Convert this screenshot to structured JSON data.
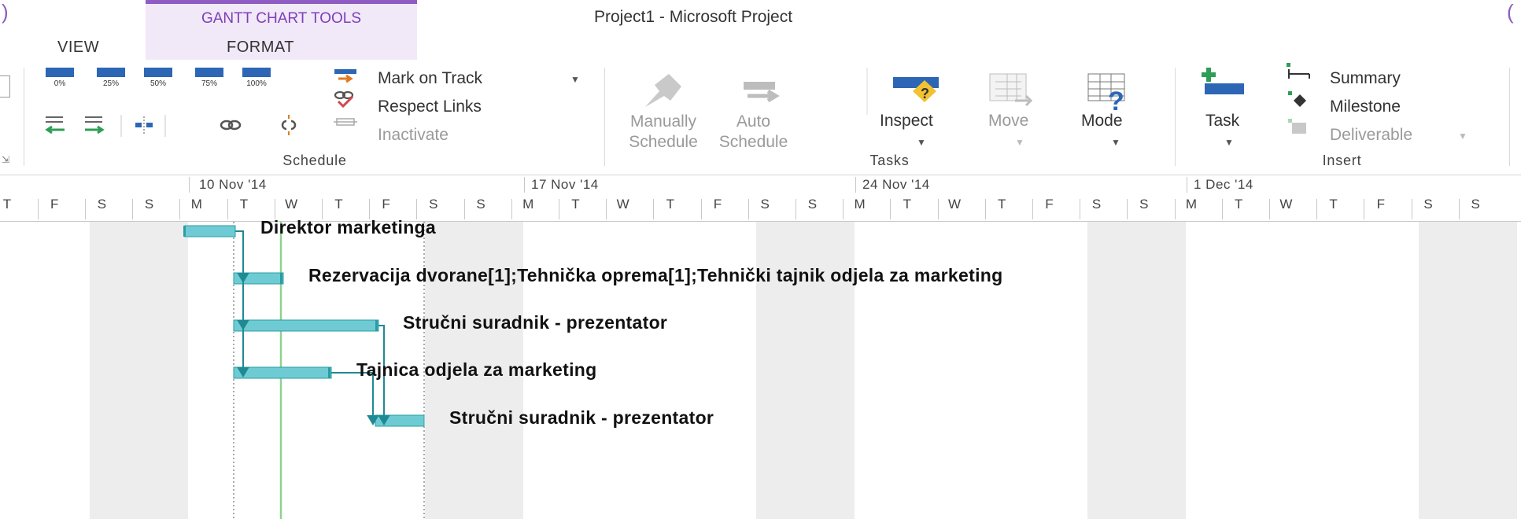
{
  "window": {
    "title": "Project1 - Microsoft Project",
    "contextual_tab_group": "GANTT CHART TOOLS"
  },
  "tabs": [
    {
      "label": "VIEW"
    },
    {
      "label": "FORMAT"
    }
  ],
  "ribbon": {
    "schedule": {
      "label": "Schedule",
      "percent_buttons": [
        "0%",
        "25%",
        "50%",
        "75%",
        "100%"
      ],
      "mark_on_track": "Mark on Track",
      "respect_links": "Respect Links",
      "inactivate": "Inactivate"
    },
    "tasks": {
      "label": "Tasks",
      "manually_schedule": [
        "Manually",
        "Schedule"
      ],
      "auto_schedule": [
        "Auto",
        "Schedule"
      ],
      "inspect": "Inspect",
      "move": "Move",
      "mode": "Mode"
    },
    "insert": {
      "label": "Insert",
      "task": "Task",
      "summary": "Summary",
      "milestone": "Milestone",
      "deliverable": "Deliverable"
    }
  },
  "timescale": {
    "weeks": [
      "10 Nov '14",
      "17 Nov '14",
      "24 Nov '14",
      "1 Dec '14"
    ],
    "days": [
      "T",
      "F",
      "S",
      "S",
      "M",
      "T",
      "W",
      "T",
      "F",
      "S",
      "S",
      "M",
      "T",
      "W",
      "T",
      "F",
      "S",
      "S",
      "M",
      "T",
      "W",
      "T",
      "F",
      "S",
      "S",
      "M",
      "T",
      "W",
      "T",
      "F",
      "S",
      "S"
    ]
  },
  "gantt": {
    "tasks": [
      {
        "resources": "Direktor marketinga"
      },
      {
        "resources": "Rezervacija dvorane[1];Tehnička oprema[1];Tehnički tajnik odjela za marketing"
      },
      {
        "resources": "Stručni suradnik - prezentator"
      },
      {
        "resources": "Tajnica odjela za marketing"
      },
      {
        "resources": "Stručni suradnik - prezentator"
      }
    ],
    "colors": {
      "bar": "#6fcbd3",
      "bar_edge": "#2a9ca6",
      "link": "#1f8a93",
      "weekend": "#ededed",
      "today_line": "#8fd28f",
      "contextual_accent": "#8e5cc2"
    }
  }
}
